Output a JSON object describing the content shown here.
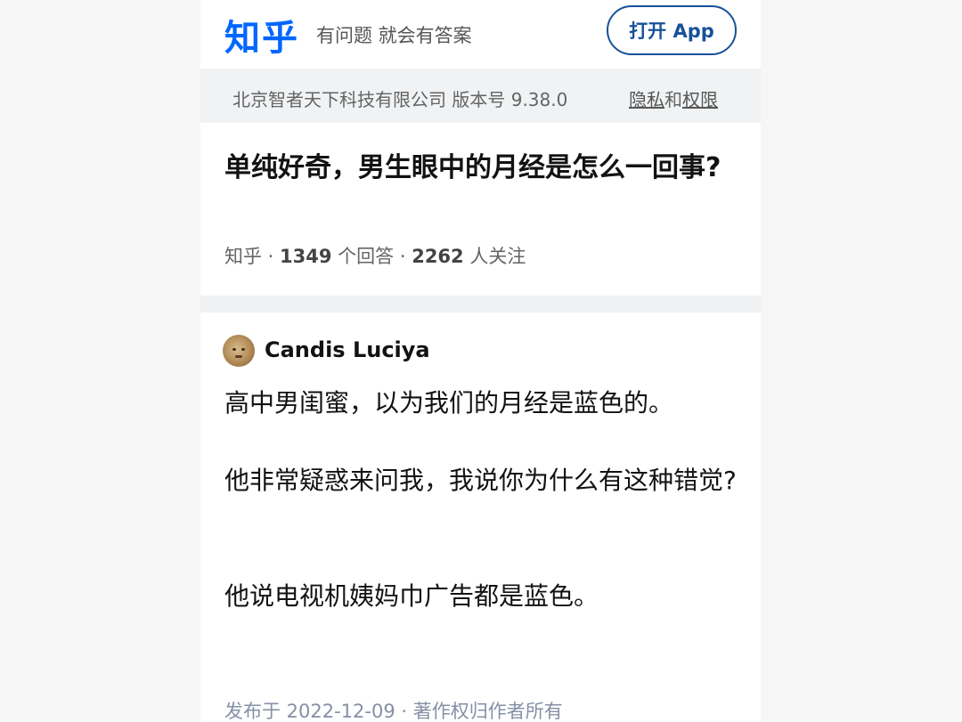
{
  "header": {
    "logo": "知乎",
    "slogan": "有问题 就会有答案",
    "open_app_label": "打开 App"
  },
  "infobar": {
    "company": "北京智者天下科技有限公司 版本号 9.38.0",
    "privacy_link": "隐私",
    "and": "和",
    "permissions_link": "权限"
  },
  "question": {
    "title": "单纯好奇，男生眼中的月经是怎么一回事?",
    "source": "知乎",
    "sep1": " · ",
    "answers_count": "1349",
    "answers_unit": " 个回答",
    "sep2": " · ",
    "followers_count": "2262",
    "followers_unit": " 人关注"
  },
  "answer": {
    "author": "Candis Luciya",
    "paragraphs": [
      "高中男闺蜜，以为我们的月经是蓝色的。",
      "他非常疑惑来问我，我说你为什么有这种错觉?",
      "他说电视机姨妈巾广告都是蓝色。"
    ],
    "published": "发布于 2022-12-09 · 著作权归作者所有"
  },
  "colors": {
    "brand": "#0066ff",
    "button": "#175199",
    "text": "#121212",
    "meta": "#646464"
  }
}
